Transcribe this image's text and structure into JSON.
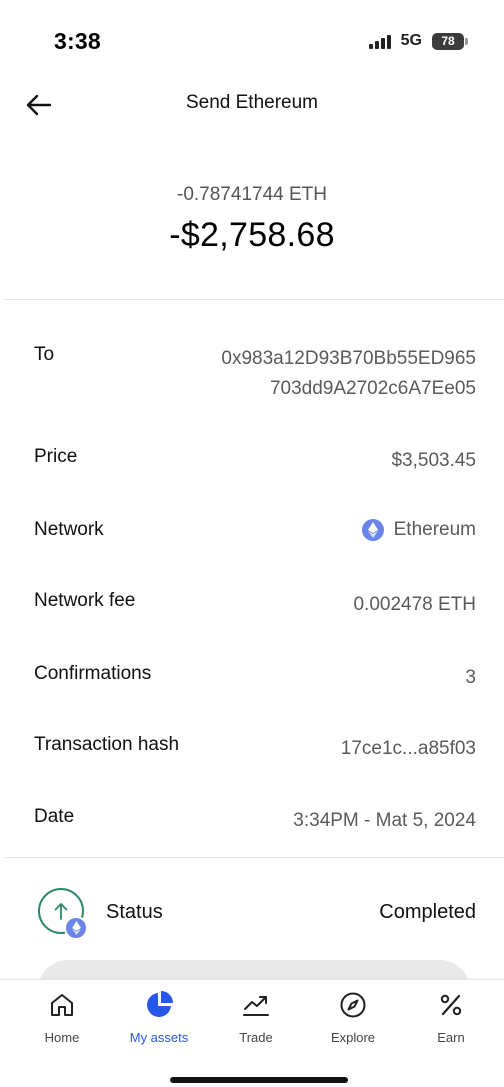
{
  "status_bar": {
    "time": "3:38",
    "network": "5G",
    "battery": "78"
  },
  "header": {
    "title": "Send Ethereum",
    "back_icon": "arrow-left-icon"
  },
  "amount": {
    "crypto": "-0.78741744 ETH",
    "fiat": "-$2,758.68"
  },
  "details": {
    "to_label": "To",
    "to_line1": "0x983a12D93B70Bb55ED965",
    "to_line2": "703dd9A2702c6A7Ee05",
    "price_label": "Price",
    "price_value": "$3,503.45",
    "network_label": "Network",
    "network_value": "Ethereum",
    "network_icon": "ethereum-icon",
    "fee_label": "Network fee",
    "fee_value": "0.002478 ETH",
    "confirmations_label": "Confirmations",
    "confirmations_value": "3",
    "hash_label": "Transaction hash",
    "hash_value": "17ce1c...a85f03",
    "date_label": "Date",
    "date_value": "3:34PM - Mat 5, 2024"
  },
  "status": {
    "label": "Status",
    "value": "Completed",
    "icon": "arrow-up-icon",
    "color": "#2a8a62"
  },
  "nav": {
    "active_color": "#2657e8",
    "items": [
      {
        "label": "Home",
        "icon": "home-icon"
      },
      {
        "label": "My assets",
        "icon": "pie-chart-icon"
      },
      {
        "label": "Trade",
        "icon": "trend-up-icon"
      },
      {
        "label": "Explore",
        "icon": "compass-icon"
      },
      {
        "label": "Earn",
        "icon": "percent-icon"
      }
    ]
  }
}
